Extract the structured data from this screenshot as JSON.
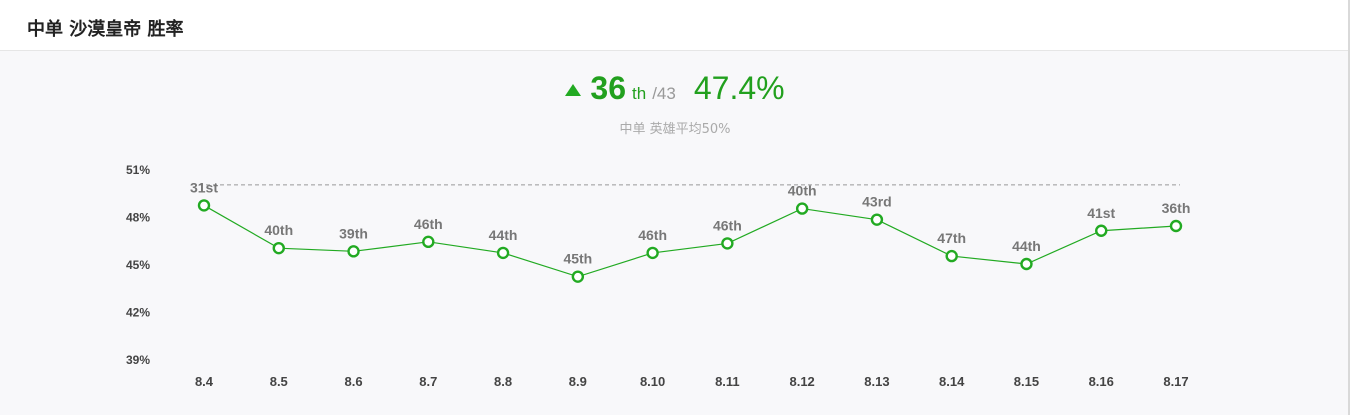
{
  "header": {
    "title": "中单 沙漠皇帝 胜率"
  },
  "summary": {
    "rank": "36",
    "rank_suffix": "th",
    "rank_total": "/43",
    "win_rate": "47.4%",
    "note": "中单 英雄平均50%"
  },
  "colors": {
    "accent": "#22a01e",
    "line": "#22aa22",
    "reference": "#999999"
  },
  "chart_data": {
    "type": "line",
    "categories": [
      "8.4",
      "8.5",
      "8.6",
      "8.7",
      "8.8",
      "8.9",
      "8.10",
      "8.11",
      "8.12",
      "8.13",
      "8.14",
      "8.15",
      "8.16",
      "8.17"
    ],
    "series": [
      {
        "values": [
          48.7,
          46.0,
          45.8,
          46.4,
          45.7,
          44.2,
          45.7,
          46.3,
          48.5,
          47.8,
          45.5,
          45.0,
          47.1,
          47.4
        ],
        "labels": [
          "31st",
          "40th",
          "39th",
          "46th",
          "44th",
          "45th",
          "46th",
          "46th",
          "40th",
          "43rd",
          "47th",
          "44th",
          "41st",
          "36th"
        ]
      }
    ],
    "reference_line": 50,
    "ylim": [
      39,
      51
    ],
    "yticks": [
      51,
      48,
      45,
      42,
      39
    ],
    "ytick_labels": [
      "51%",
      "48%",
      "45%",
      "42%",
      "39%"
    ],
    "grid": false
  }
}
